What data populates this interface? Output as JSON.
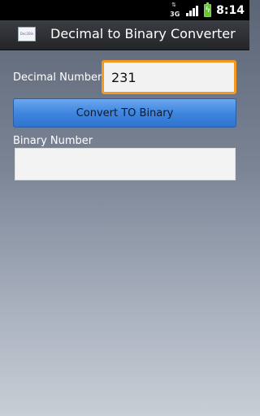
{
  "status_bar": {
    "network_type": "3G",
    "time": "8:14",
    "icons": [
      "network-3g-icon",
      "signal-bars-icon",
      "battery-charging-icon"
    ]
  },
  "title_bar": {
    "title": "Decimal to Binary Converter",
    "app_icon_text": "Dec2Bin"
  },
  "form": {
    "decimal_label": "Decimal Number",
    "decimal_value": "231",
    "convert_button": "Convert TO Binary",
    "binary_label": "Binary Number",
    "binary_value": ""
  },
  "colors": {
    "focus_border": "#f39a1e",
    "button_blue": "#3f86e0",
    "battery_green": "#6cc33a"
  }
}
